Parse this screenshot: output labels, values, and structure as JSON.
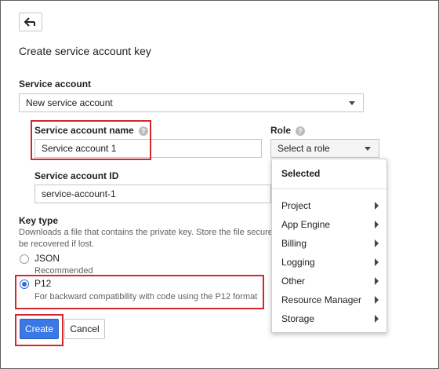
{
  "header": {
    "back_icon": "back-arrow-icon",
    "title": "Create service account key"
  },
  "service_account": {
    "label": "Service account",
    "selected": "New service account"
  },
  "name_field": {
    "label": "Service account name",
    "value": "Service account 1"
  },
  "role": {
    "label": "Role",
    "placeholder": "Select a role",
    "dropdown": {
      "header": "Selected",
      "items": [
        {
          "label": "Project"
        },
        {
          "label": "App Engine"
        },
        {
          "label": "Billing"
        },
        {
          "label": "Logging"
        },
        {
          "label": "Other"
        },
        {
          "label": "Resource Manager"
        },
        {
          "label": "Storage"
        }
      ]
    }
  },
  "id_field": {
    "label": "Service account ID",
    "value": "service-account-1"
  },
  "key_type": {
    "label": "Key type",
    "description_line1": "Downloads a file that contains the private key. Store the file secure",
    "description_line2": "be recovered if lost.",
    "options": [
      {
        "label": "JSON",
        "sub": "Recommended",
        "selected": false
      },
      {
        "label": "P12",
        "sub": "For backward compatibility with code using the P12 format",
        "selected": true
      }
    ]
  },
  "actions": {
    "create": "Create",
    "cancel": "Cancel"
  },
  "colors": {
    "primary": "#3b78e7",
    "highlight": "#d3262d",
    "radio": "#3367d6"
  }
}
